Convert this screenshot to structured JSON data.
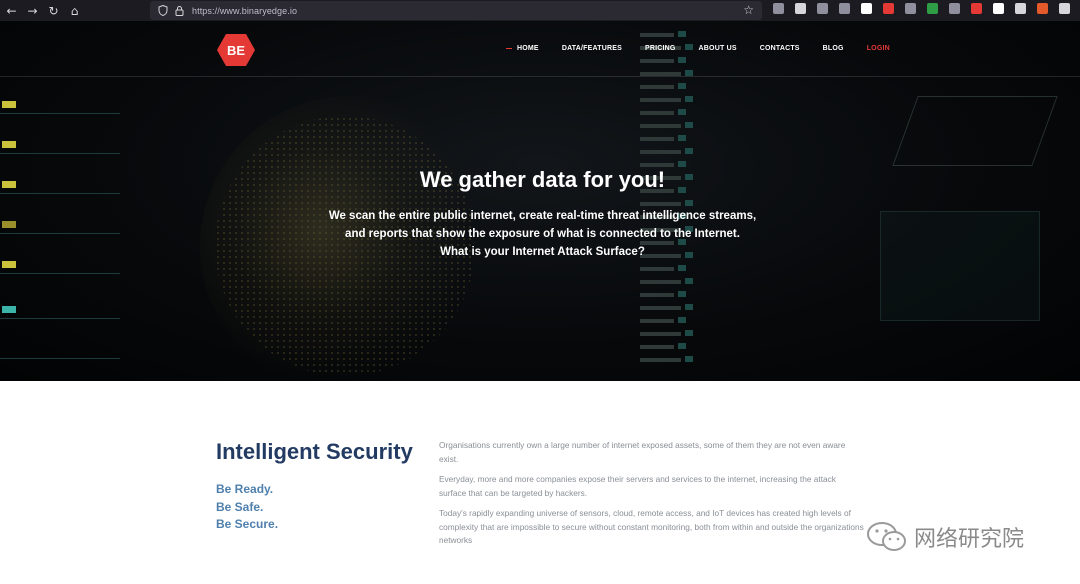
{
  "browser": {
    "url": "https://www.binaryedge.io",
    "icons": [
      "back-arrow-icon",
      "forward-arrow-icon",
      "reload-icon",
      "home-icon",
      "shield-icon",
      "lock-icon",
      "star-icon"
    ],
    "nav_glyphs": {
      "back": "←",
      "forward": "→",
      "reload": "↻",
      "home": "⌂",
      "star": "☆"
    },
    "extension_colors": [
      "#8f8f9d",
      "#d7d7db",
      "#8f8f9d",
      "#8f8f9d",
      "#ffffff",
      "#e53935",
      "#8f8f9d",
      "#2e9d46",
      "#8f8f9d",
      "#e53935",
      "#ffffff",
      "#d7d7db",
      "#e55a2b",
      "#d7d7db"
    ]
  },
  "site": {
    "logo_text": "BE",
    "logo_color": "#e53935",
    "nav": [
      {
        "label": "HOME",
        "active": true
      },
      {
        "label": "DATA/FEATURES",
        "active": false
      },
      {
        "label": "PRICING",
        "active": false
      },
      {
        "label": "ABOUT US",
        "active": false
      },
      {
        "label": "CONTACTS",
        "active": false
      },
      {
        "label": "BLOG",
        "active": false
      },
      {
        "label": "LOGIN",
        "active": false
      }
    ]
  },
  "hero": {
    "title": "We gather data for you!",
    "lines": [
      "We scan the entire public internet, create real-time threat intelligence streams,",
      "and reports that show the exposure of what is connected to the Internet.",
      "What is your Internet Attack Surface?"
    ]
  },
  "content": {
    "heading": "Intelligent Security",
    "tagline": [
      "Be Ready.",
      "Be Safe.",
      "Be Secure."
    ],
    "paragraphs": [
      "Organisations currently own a large number of internet exposed assets, some of them they are not even aware exist.",
      "Everyday, more and more companies expose their servers and services to the internet, increasing the attack surface that can be targeted by hackers.",
      "Today's rapidly expanding universe of sensors, cloud, remote access, and IoT devices has created high levels of complexity that are impossible to secure without constant monitoring, both from within and outside the organizations networks"
    ]
  },
  "watermark": {
    "text": "网络研究院"
  },
  "colors": {
    "accent": "#e53935",
    "heading": "#233b63",
    "tagline": "#4f80ad",
    "body": "#8a8f96"
  }
}
